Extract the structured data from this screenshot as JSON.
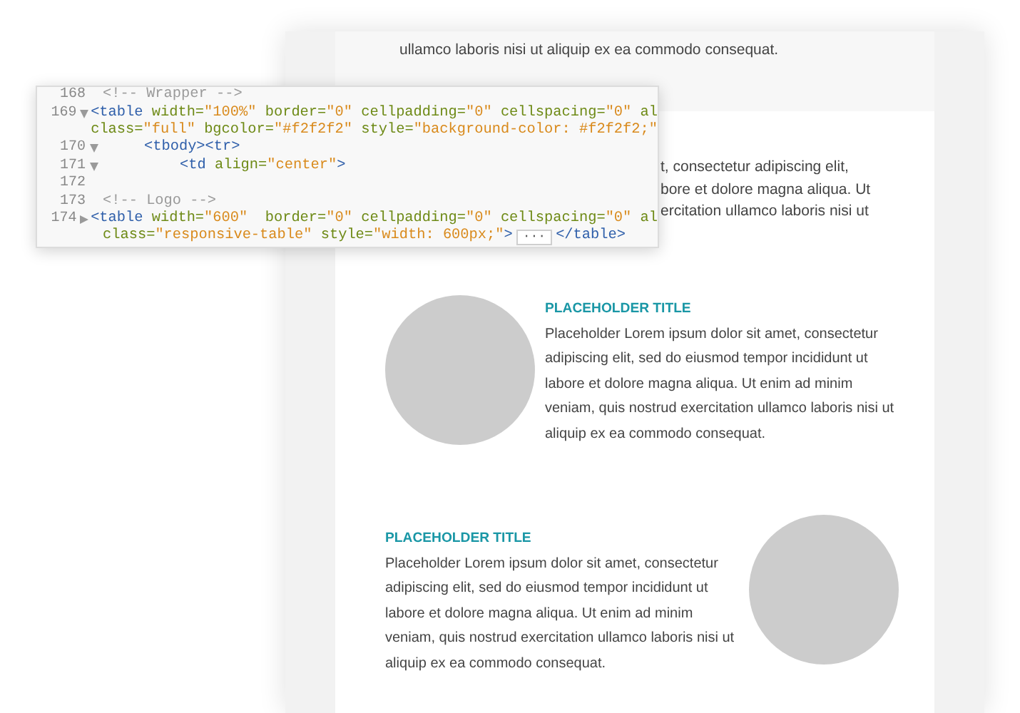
{
  "email_preview": {
    "top_section": {
      "text": "ullamco laboris nisi ut aliquip ex ea commodo consequat."
    },
    "intro_lines": [
      "t, consectetur adipiscing elit,",
      "bore et dolore magna aliqua. Ut",
      "ercitation ullamco laboris nisi ut"
    ],
    "features": [
      {
        "kind": "image-left",
        "title": "PLACEHOLDER TITLE",
        "body": "Placeholder Lorem ipsum dolor sit amet, consectetur adipiscing elit, sed do eiusmod tempor incididunt ut labore et dolore magna aliqua. Ut enim ad minim veniam, quis nostrud exercitation ullamco laboris nisi ut aliquip ex ea commodo consequat."
      },
      {
        "kind": "image-right",
        "title": "PLACEHOLDER TITLE",
        "body": "Placeholder Lorem ipsum dolor sit amet, consectetur adipiscing elit, sed do eiusmod tempor incididunt ut labore et dolore magna aliqua. Ut enim ad minim veniam, quis nostrud exercitation ullamco laboris nisi ut aliquip ex ea commodo consequat."
      }
    ]
  },
  "code_panel": {
    "lines": [
      {
        "number": "168",
        "tokens": [
          {
            "kind": "comment",
            "text": "<!-- Wrapper -->"
          }
        ]
      },
      {
        "number": "169",
        "expanded": true,
        "tokens": [
          {
            "kind": "tag",
            "text": "<table "
          },
          {
            "kind": "attr",
            "text": "width="
          },
          {
            "kind": "value",
            "text": "\"100%\""
          },
          {
            "kind": "attr",
            "text": " border="
          },
          {
            "kind": "value",
            "text": "\"0\""
          },
          {
            "kind": "attr",
            "text": " cellpadding="
          },
          {
            "kind": "value",
            "text": "\"0\""
          },
          {
            "kind": "attr",
            "text": " cellspacing="
          },
          {
            "kind": "value",
            "text": "\"0\""
          },
          {
            "kind": "attr",
            "text": " al"
          }
        ]
      },
      {
        "tokens": [
          {
            "kind": "attr",
            "text": "class="
          },
          {
            "kind": "value",
            "text": "\"full\""
          },
          {
            "kind": "attr",
            "text": " bgcolor="
          },
          {
            "kind": "value",
            "text": "\"#f2f2f2\""
          },
          {
            "kind": "attr",
            "text": " style="
          },
          {
            "kind": "value",
            "text": "\"background-color: #f2f2f2;\""
          }
        ]
      },
      {
        "number": "170",
        "expanded": true,
        "kind": "indent-1",
        "tokens": [
          {
            "kind": "tag",
            "text": "<tbody><tr>"
          }
        ]
      },
      {
        "number": "171",
        "expanded": true,
        "kind": "indent-2",
        "tokens": [
          {
            "kind": "tag",
            "text": "<td "
          },
          {
            "kind": "attr",
            "text": "align="
          },
          {
            "kind": "value",
            "text": "\"center\""
          },
          {
            "kind": "tag",
            "text": ">"
          }
        ]
      },
      {
        "number": "172"
      },
      {
        "number": "173",
        "tokens": [
          {
            "kind": "comment",
            "text": "<!-- Logo -->"
          }
        ]
      },
      {
        "number": "174",
        "expanded": false,
        "tokens": [
          {
            "kind": "tag",
            "text": "<table "
          },
          {
            "kind": "attr",
            "text": "width="
          },
          {
            "kind": "value",
            "text": "\"600\""
          },
          {
            "kind": "attr",
            "text": "  border="
          },
          {
            "kind": "value",
            "text": "\"0\""
          },
          {
            "kind": "attr",
            "text": " cellpadding="
          },
          {
            "kind": "value",
            "text": "\"0\""
          },
          {
            "kind": "attr",
            "text": " cellspacing="
          },
          {
            "kind": "value",
            "text": "\"0\""
          },
          {
            "kind": "attr",
            "text": " al"
          }
        ]
      },
      {
        "tokens": [
          {
            "kind": "attr",
            "text": "class="
          },
          {
            "kind": "value",
            "text": "\"responsive-table\""
          },
          {
            "kind": "attr",
            "text": " style="
          },
          {
            "kind": "value",
            "text": "\"width: 600px;\""
          },
          {
            "kind": "tag",
            "text": ">"
          },
          {
            "kind": "ellipsis",
            "text": "···"
          },
          {
            "kind": "tag",
            "text": "</table>"
          }
        ]
      }
    ]
  }
}
